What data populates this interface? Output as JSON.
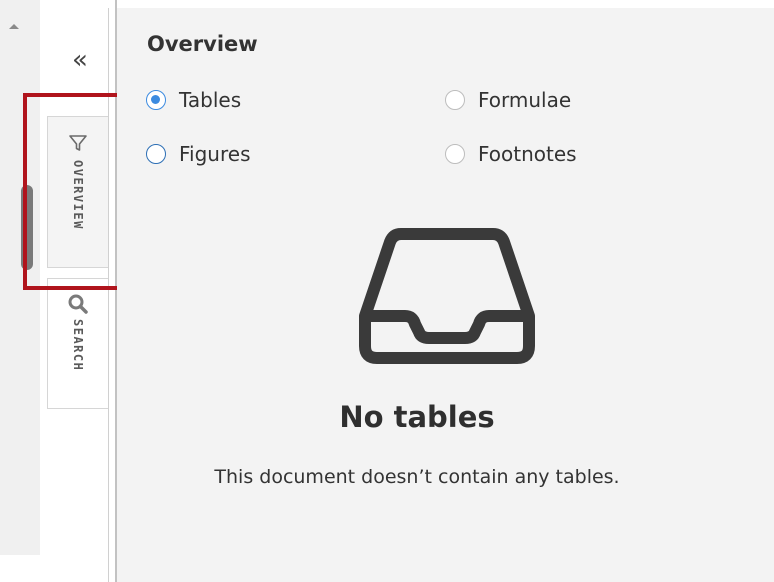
{
  "sidebar": {
    "collapse_glyph": "«",
    "tabs": [
      {
        "label": "OVERVIEW",
        "icon": "filter-icon",
        "active": true
      },
      {
        "label": "SEARCH",
        "icon": "search-icon",
        "active": false
      }
    ]
  },
  "panel": {
    "title": "Overview",
    "options": [
      {
        "label": "Tables",
        "checked": true
      },
      {
        "label": "Formulae",
        "checked": false
      },
      {
        "label": "Figures",
        "checked": false
      },
      {
        "label": "Footnotes",
        "checked": false
      }
    ],
    "empty_state": {
      "icon": "inbox-tray-icon",
      "title": "No tables",
      "description": "This document doesn’t contain any tables."
    }
  },
  "colors": {
    "accent": "#3c8be0",
    "highlight": "#b0141c",
    "panel_bg": "#f3f3f3"
  }
}
